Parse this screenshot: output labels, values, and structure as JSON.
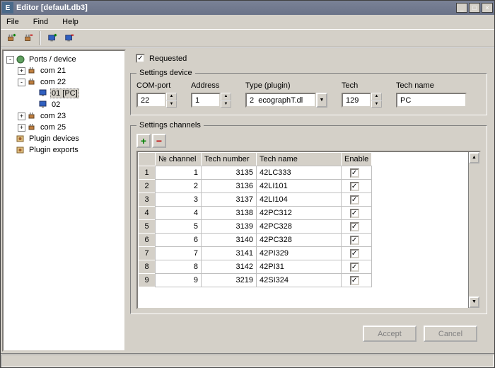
{
  "window": {
    "title": "Editor [default.db3]",
    "app_icon_letter": "E"
  },
  "menu": {
    "file": "File",
    "find": "Find",
    "help": "Help"
  },
  "tree": {
    "root": "Ports / device",
    "com21": "com 21",
    "com22": "com 22",
    "com22_01": "01 [PC]",
    "com22_02": "02",
    "com23": "com 23",
    "com25": "com 25",
    "plugin_devices": "Plugin devices",
    "plugin_exports": "Plugin exports"
  },
  "requested": {
    "label": "Requested",
    "checked": "✓"
  },
  "settings_device": {
    "legend": "Settings device",
    "com_port": {
      "label": "COM-port",
      "value": "22"
    },
    "address": {
      "label": "Address",
      "value": "1"
    },
    "type": {
      "label": "Type (plugin)",
      "value": "2  ecographT.dl"
    },
    "tech": {
      "label": "Tech",
      "value": "129"
    },
    "tech_name": {
      "label": "Tech name",
      "value": "PC"
    }
  },
  "settings_channels": {
    "legend": "Settings channels",
    "columns": {
      "row": "",
      "channel": "№ channel",
      "tech_number": "Tech number",
      "tech_name": "Tech name",
      "enable": "Enable"
    },
    "rows": [
      {
        "n": "1",
        "channel": "1",
        "tech_number": "3135",
        "tech_name": "42LC333",
        "enable": "✓"
      },
      {
        "n": "2",
        "channel": "2",
        "tech_number": "3136",
        "tech_name": "42LI101",
        "enable": "✓"
      },
      {
        "n": "3",
        "channel": "3",
        "tech_number": "3137",
        "tech_name": "42LI104",
        "enable": "✓"
      },
      {
        "n": "4",
        "channel": "4",
        "tech_number": "3138",
        "tech_name": "42PC312",
        "enable": "✓"
      },
      {
        "n": "5",
        "channel": "5",
        "tech_number": "3139",
        "tech_name": "42PC328",
        "enable": "✓"
      },
      {
        "n": "6",
        "channel": "6",
        "tech_number": "3140",
        "tech_name": "42PC328",
        "enable": "✓"
      },
      {
        "n": "7",
        "channel": "7",
        "tech_number": "3141",
        "tech_name": "42PI329",
        "enable": "✓"
      },
      {
        "n": "8",
        "channel": "8",
        "tech_number": "3142",
        "tech_name": "42PI31",
        "enable": "✓"
      },
      {
        "n": "9",
        "channel": "9",
        "tech_number": "3219",
        "tech_name": "42SI324",
        "enable": "✓"
      }
    ]
  },
  "footer": {
    "accept": "Accept",
    "cancel": "Cancel"
  }
}
